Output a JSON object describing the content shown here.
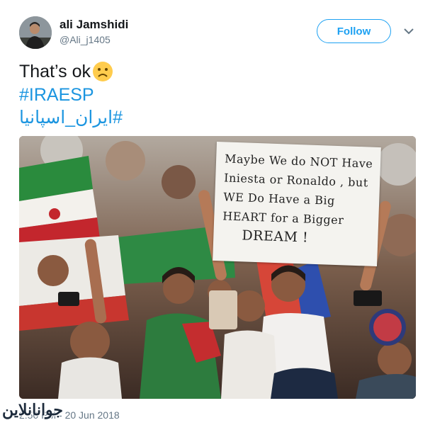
{
  "user": {
    "name": "ali Jamshidi",
    "handle": "@Ali_j1405"
  },
  "follow": {
    "label": "Follow"
  },
  "tweet": {
    "text": "That’s ok",
    "hashtags": [
      "#IRAESP",
      "#ایران_اسپانیا"
    ]
  },
  "photo": {
    "sign_lines": [
      "Maybe We do NOT Have",
      "Iniesta or Ronaldo , but",
      "WE Do Have a Big",
      "HEART for a Bigger",
      "DREAM !"
    ]
  },
  "footer": {
    "timestamp": "2:50 PM - 20 Jun 2018"
  },
  "watermark": {
    "text": "جوانانلاین"
  },
  "icons": {
    "emoji": "sad-face-icon",
    "menu": "chevron-down-icon"
  },
  "colors": {
    "accent": "#1da1f2",
    "hashtag": "#1b95e0",
    "secondary_text": "#657786"
  }
}
